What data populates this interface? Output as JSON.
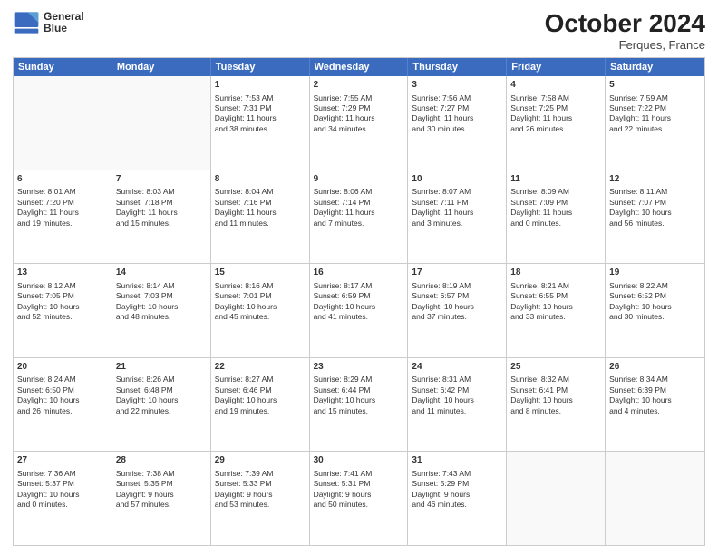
{
  "header": {
    "logo_line1": "General",
    "logo_line2": "Blue",
    "month_year": "October 2024",
    "location": "Ferques, France"
  },
  "weekdays": [
    "Sunday",
    "Monday",
    "Tuesday",
    "Wednesday",
    "Thursday",
    "Friday",
    "Saturday"
  ],
  "rows": [
    [
      {
        "day": "",
        "empty": true
      },
      {
        "day": "",
        "empty": true
      },
      {
        "day": "1",
        "lines": [
          "Sunrise: 7:53 AM",
          "Sunset: 7:31 PM",
          "Daylight: 11 hours",
          "and 38 minutes."
        ]
      },
      {
        "day": "2",
        "lines": [
          "Sunrise: 7:55 AM",
          "Sunset: 7:29 PM",
          "Daylight: 11 hours",
          "and 34 minutes."
        ]
      },
      {
        "day": "3",
        "lines": [
          "Sunrise: 7:56 AM",
          "Sunset: 7:27 PM",
          "Daylight: 11 hours",
          "and 30 minutes."
        ]
      },
      {
        "day": "4",
        "lines": [
          "Sunrise: 7:58 AM",
          "Sunset: 7:25 PM",
          "Daylight: 11 hours",
          "and 26 minutes."
        ]
      },
      {
        "day": "5",
        "lines": [
          "Sunrise: 7:59 AM",
          "Sunset: 7:22 PM",
          "Daylight: 11 hours",
          "and 22 minutes."
        ]
      }
    ],
    [
      {
        "day": "6",
        "lines": [
          "Sunrise: 8:01 AM",
          "Sunset: 7:20 PM",
          "Daylight: 11 hours",
          "and 19 minutes."
        ]
      },
      {
        "day": "7",
        "lines": [
          "Sunrise: 8:03 AM",
          "Sunset: 7:18 PM",
          "Daylight: 11 hours",
          "and 15 minutes."
        ]
      },
      {
        "day": "8",
        "lines": [
          "Sunrise: 8:04 AM",
          "Sunset: 7:16 PM",
          "Daylight: 11 hours",
          "and 11 minutes."
        ]
      },
      {
        "day": "9",
        "lines": [
          "Sunrise: 8:06 AM",
          "Sunset: 7:14 PM",
          "Daylight: 11 hours",
          "and 7 minutes."
        ]
      },
      {
        "day": "10",
        "lines": [
          "Sunrise: 8:07 AM",
          "Sunset: 7:11 PM",
          "Daylight: 11 hours",
          "and 3 minutes."
        ]
      },
      {
        "day": "11",
        "lines": [
          "Sunrise: 8:09 AM",
          "Sunset: 7:09 PM",
          "Daylight: 11 hours",
          "and 0 minutes."
        ]
      },
      {
        "day": "12",
        "lines": [
          "Sunrise: 8:11 AM",
          "Sunset: 7:07 PM",
          "Daylight: 10 hours",
          "and 56 minutes."
        ]
      }
    ],
    [
      {
        "day": "13",
        "lines": [
          "Sunrise: 8:12 AM",
          "Sunset: 7:05 PM",
          "Daylight: 10 hours",
          "and 52 minutes."
        ]
      },
      {
        "day": "14",
        "lines": [
          "Sunrise: 8:14 AM",
          "Sunset: 7:03 PM",
          "Daylight: 10 hours",
          "and 48 minutes."
        ]
      },
      {
        "day": "15",
        "lines": [
          "Sunrise: 8:16 AM",
          "Sunset: 7:01 PM",
          "Daylight: 10 hours",
          "and 45 minutes."
        ]
      },
      {
        "day": "16",
        "lines": [
          "Sunrise: 8:17 AM",
          "Sunset: 6:59 PM",
          "Daylight: 10 hours",
          "and 41 minutes."
        ]
      },
      {
        "day": "17",
        "lines": [
          "Sunrise: 8:19 AM",
          "Sunset: 6:57 PM",
          "Daylight: 10 hours",
          "and 37 minutes."
        ]
      },
      {
        "day": "18",
        "lines": [
          "Sunrise: 8:21 AM",
          "Sunset: 6:55 PM",
          "Daylight: 10 hours",
          "and 33 minutes."
        ]
      },
      {
        "day": "19",
        "lines": [
          "Sunrise: 8:22 AM",
          "Sunset: 6:52 PM",
          "Daylight: 10 hours",
          "and 30 minutes."
        ]
      }
    ],
    [
      {
        "day": "20",
        "lines": [
          "Sunrise: 8:24 AM",
          "Sunset: 6:50 PM",
          "Daylight: 10 hours",
          "and 26 minutes."
        ]
      },
      {
        "day": "21",
        "lines": [
          "Sunrise: 8:26 AM",
          "Sunset: 6:48 PM",
          "Daylight: 10 hours",
          "and 22 minutes."
        ]
      },
      {
        "day": "22",
        "lines": [
          "Sunrise: 8:27 AM",
          "Sunset: 6:46 PM",
          "Daylight: 10 hours",
          "and 19 minutes."
        ]
      },
      {
        "day": "23",
        "lines": [
          "Sunrise: 8:29 AM",
          "Sunset: 6:44 PM",
          "Daylight: 10 hours",
          "and 15 minutes."
        ]
      },
      {
        "day": "24",
        "lines": [
          "Sunrise: 8:31 AM",
          "Sunset: 6:42 PM",
          "Daylight: 10 hours",
          "and 11 minutes."
        ]
      },
      {
        "day": "25",
        "lines": [
          "Sunrise: 8:32 AM",
          "Sunset: 6:41 PM",
          "Daylight: 10 hours",
          "and 8 minutes."
        ]
      },
      {
        "day": "26",
        "lines": [
          "Sunrise: 8:34 AM",
          "Sunset: 6:39 PM",
          "Daylight: 10 hours",
          "and 4 minutes."
        ]
      }
    ],
    [
      {
        "day": "27",
        "lines": [
          "Sunrise: 7:36 AM",
          "Sunset: 5:37 PM",
          "Daylight: 10 hours",
          "and 0 minutes."
        ]
      },
      {
        "day": "28",
        "lines": [
          "Sunrise: 7:38 AM",
          "Sunset: 5:35 PM",
          "Daylight: 9 hours",
          "and 57 minutes."
        ]
      },
      {
        "day": "29",
        "lines": [
          "Sunrise: 7:39 AM",
          "Sunset: 5:33 PM",
          "Daylight: 9 hours",
          "and 53 minutes."
        ]
      },
      {
        "day": "30",
        "lines": [
          "Sunrise: 7:41 AM",
          "Sunset: 5:31 PM",
          "Daylight: 9 hours",
          "and 50 minutes."
        ]
      },
      {
        "day": "31",
        "lines": [
          "Sunrise: 7:43 AM",
          "Sunset: 5:29 PM",
          "Daylight: 9 hours",
          "and 46 minutes."
        ]
      },
      {
        "day": "",
        "empty": true
      },
      {
        "day": "",
        "empty": true
      }
    ]
  ]
}
